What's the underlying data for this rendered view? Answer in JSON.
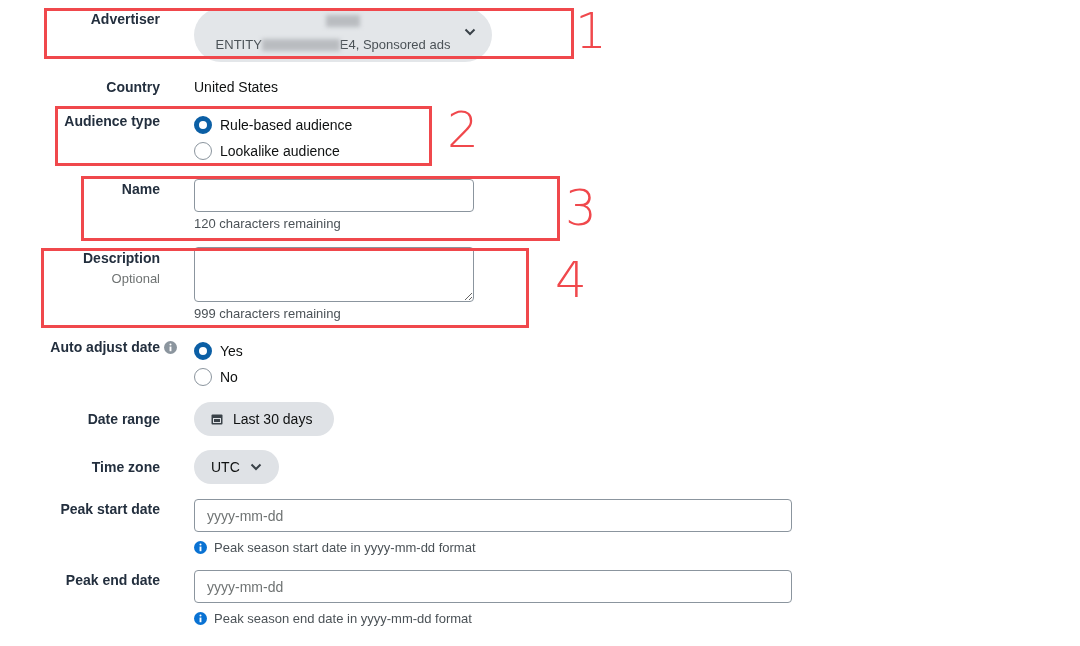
{
  "fields": [
    {
      "kind": "select",
      "label": "Advertiser",
      "value_prefix": "ENTITY",
      "value_suffix": "E4, Sponsored ads"
    },
    {
      "kind": "static",
      "label": "Country",
      "value": "United States"
    },
    {
      "kind": "radio",
      "label": "Audience type",
      "options": [
        {
          "label": "Rule-based audience",
          "selected": true
        },
        {
          "label": "Lookalike audience",
          "selected": false
        }
      ]
    },
    {
      "kind": "input",
      "label": "Name",
      "helper": "120 characters remaining"
    },
    {
      "kind": "textarea",
      "label": "Description",
      "sublabel": "Optional",
      "helper": "999 characters remaining"
    },
    {
      "kind": "radio",
      "label": "Auto adjust date",
      "info": true,
      "options": [
        {
          "label": "Yes",
          "selected": true
        },
        {
          "label": "No",
          "selected": false
        }
      ]
    },
    {
      "kind": "date",
      "label": "Date range",
      "value": "Last 30 days"
    },
    {
      "kind": "dropdown",
      "label": "Time zone",
      "value": "UTC"
    },
    {
      "kind": "input",
      "label": "Peak start date",
      "placeholder": "yyyy-mm-dd",
      "hint": "Peak season start date in yyyy-mm-dd format"
    },
    {
      "kind": "input",
      "label": "Peak end date",
      "placeholder": "yyyy-mm-dd",
      "hint": "Peak season end date in yyyy-mm-dd format"
    }
  ],
  "annotations": [
    {
      "label": "1"
    },
    {
      "label": "2"
    },
    {
      "label": "3"
    },
    {
      "label": "4"
    }
  ]
}
